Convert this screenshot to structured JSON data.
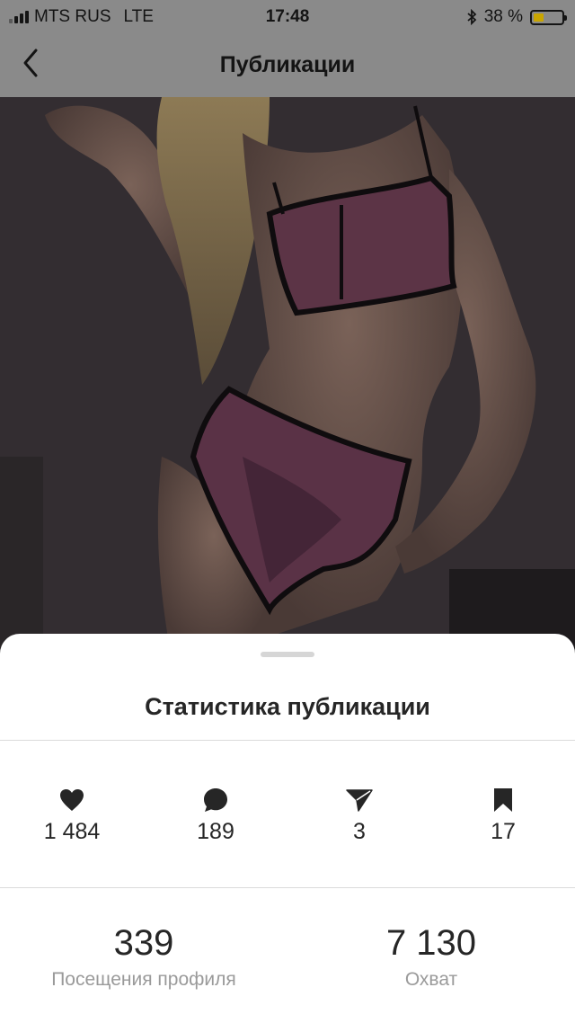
{
  "status_bar": {
    "carrier": "MTS RUS",
    "network": "LTE",
    "time": "17:48",
    "battery_text": "38 %",
    "battery_level": 0.38,
    "bluetooth_icon": "bluetooth-icon",
    "signal_bars": 4
  },
  "nav": {
    "title": "Публикации",
    "back_icon": "chevron-left-icon"
  },
  "sheet": {
    "title": "Статистика публикации",
    "metrics": [
      {
        "icon": "heart-icon",
        "value": "1 484"
      },
      {
        "icon": "comment-icon",
        "value": "189"
      },
      {
        "icon": "send-icon",
        "value": "3"
      },
      {
        "icon": "bookmark-icon",
        "value": "17"
      }
    ],
    "summary": [
      {
        "value": "339",
        "label": "Посещения профиля"
      },
      {
        "value": "7 130",
        "label": "Охват"
      }
    ]
  },
  "colors": {
    "overlay": "#8a8a8a",
    "text_primary": "#262626",
    "text_secondary": "#9a9a9a",
    "divider": "#dbdbdb",
    "battery_fill": "#c9a500"
  }
}
